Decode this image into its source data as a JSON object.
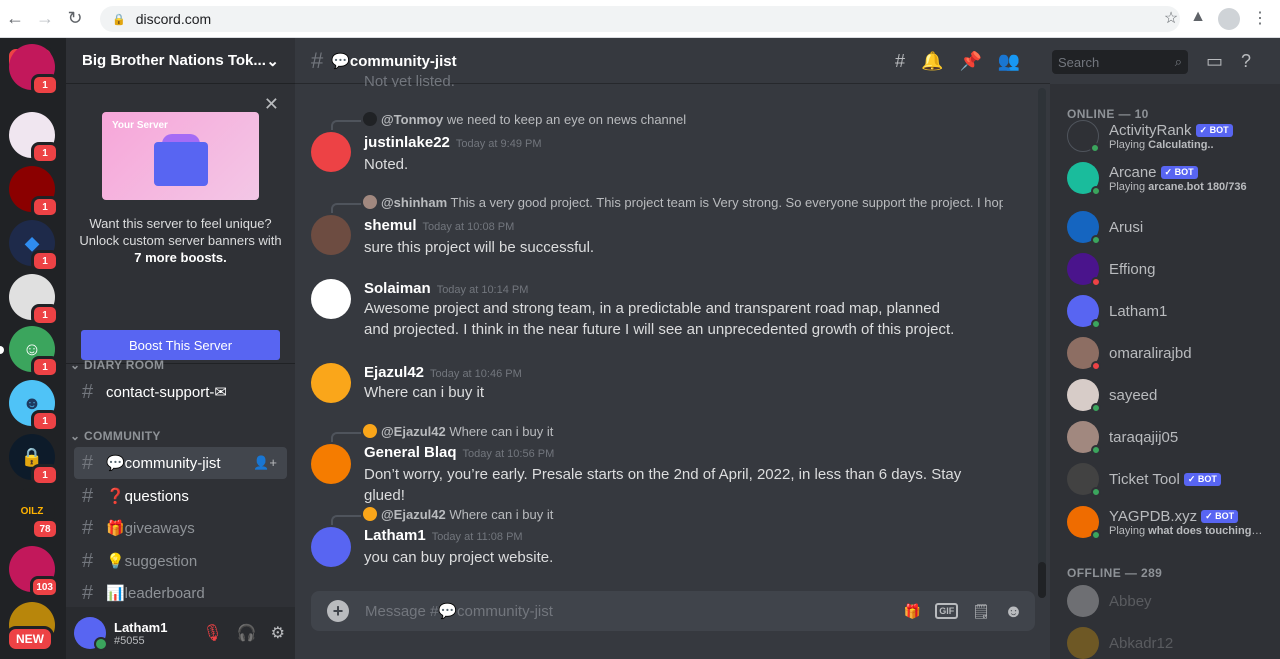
{
  "browser": {
    "url": "discord.com"
  },
  "guilds": {
    "items": [
      {
        "badge": "1",
        "color": "#c2185b"
      },
      {
        "badge": "1",
        "color": "#f0e6f0"
      },
      {
        "badge": "1",
        "color": "#8b0000"
      },
      {
        "badge": "1",
        "color": "#1e2a4a"
      },
      {
        "badge": "1",
        "color": "#e0e0e0"
      },
      {
        "badge": "1",
        "color": "#3ba55d"
      },
      {
        "badge": "1",
        "color": "#4fc3f7"
      },
      {
        "badge": "1",
        "color": "#0d1b2a"
      },
      {
        "label": "OILZ",
        "badge": "78",
        "color": "#202225"
      },
      {
        "badge": "103",
        "color": "#c2185b"
      },
      {
        "badge": "",
        "color": "#b8860b"
      }
    ],
    "new_label": "NEW"
  },
  "sidebar": {
    "server_name": "Big Brother Nations Tok...",
    "boost": {
      "banner_label": "Your Server",
      "line1": "Want this server to feel unique?",
      "line2": "Unlock custom server banners with",
      "line3": "7 more boosts.",
      "button": "Boost This Server"
    },
    "categories": [
      {
        "name": "DIARY ROOM"
      },
      {
        "name": "COMMUNITY"
      }
    ],
    "channels": [
      {
        "name": "contact-support-✉"
      },
      {
        "name": "💬community-jist"
      },
      {
        "name": "❓questions"
      },
      {
        "name": "🎁giveaways"
      },
      {
        "name": "💡suggestion"
      },
      {
        "name": "📊leaderboard"
      }
    ],
    "user": {
      "name": "Latham1",
      "tag": "#5055"
    }
  },
  "channel": {
    "title": "💬community-jist",
    "partial_top": "Not yet listed."
  },
  "messages": [
    {
      "reply_to": "@Tonmoy",
      "reply_text": "we need to keep an  eye on news channel",
      "author": "justinlake22",
      "time": "Today at 9:49 PM",
      "text": "Noted."
    },
    {
      "reply_to": "@shinham",
      "reply_text": "This a very good project. This project team is Very strong. So everyone support the project. I hop...",
      "author": "shemul",
      "time": "Today at 10:08 PM",
      "text": "sure this project will be successful."
    },
    {
      "author": "Solaiman",
      "time": "Today at 10:14 PM",
      "text": "Awesome project and strong team, in a predictable and transparent road map, planned and projected. I think in the near future I will see an unprecedented growth of this project."
    },
    {
      "author": "Ejazul42",
      "time": "Today at 10:46 PM",
      "text": "Where can i buy it"
    },
    {
      "reply_to": "@Ejazul42",
      "reply_text": "Where can i buy it",
      "author": "General Blaq",
      "time": "Today at 10:56 PM",
      "text": "Don’t worry, you’re early. Presale starts on the 2nd of April, 2022, in less than 6 days. Stay glued!"
    },
    {
      "reply_to": "@Ejazul42",
      "reply_text": "Where can i buy it",
      "author": "Latham1",
      "time": "Today at 11:08 PM",
      "text": "you can buy project website."
    }
  ],
  "composer": {
    "placeholder": "Message #💬community-jist",
    "gif": "GIF"
  },
  "search": {
    "placeholder": "Search"
  },
  "members": {
    "online_header": "ONLINE — 10",
    "offline_header": "OFFLINE — 289",
    "bot_label": "✓ BOT",
    "online": [
      {
        "name": "ActivityRank",
        "bot": true,
        "activity_prefix": "Playing",
        "activity": "Calculating..",
        "color": "#2f3136",
        "status": "#3ba55d"
      },
      {
        "name": "Arcane",
        "bot": true,
        "activity_prefix": "Playing",
        "activity": "arcane.bot 180/736",
        "color": "#1abc9c",
        "status": "#3ba55d"
      },
      {
        "name": "Arusi",
        "bot": false,
        "color": "#1565c0",
        "status": "#3ba55d"
      },
      {
        "name": "Effiong",
        "bot": false,
        "color": "#4a148c",
        "status": "#ed4245"
      },
      {
        "name": "Latham1",
        "bot": false,
        "color": "#5865f2",
        "status": "#3ba55d"
      },
      {
        "name": "omaralirajbd",
        "bot": false,
        "color": "#8d6e63",
        "status": "#ed4245"
      },
      {
        "name": "sayeed",
        "bot": false,
        "color": "#d7ccc8",
        "status": "#3ba55d"
      },
      {
        "name": "taraqajij05",
        "bot": false,
        "color": "#a1887f",
        "status": "#3ba55d"
      },
      {
        "name": "Ticket Tool",
        "bot": true,
        "color": "#424242",
        "status": "#3ba55d"
      },
      {
        "name": "YAGPDB.xyz",
        "bot": true,
        "activity_prefix": "Playing",
        "activity": "what does touching a ...",
        "color": "#ef6c00",
        "status": "#3ba55d"
      }
    ],
    "offline": [
      {
        "name": "Abbey",
        "color": "#ffffff"
      },
      {
        "name": "Abkadr12",
        "color": "#ffb300"
      }
    ]
  }
}
